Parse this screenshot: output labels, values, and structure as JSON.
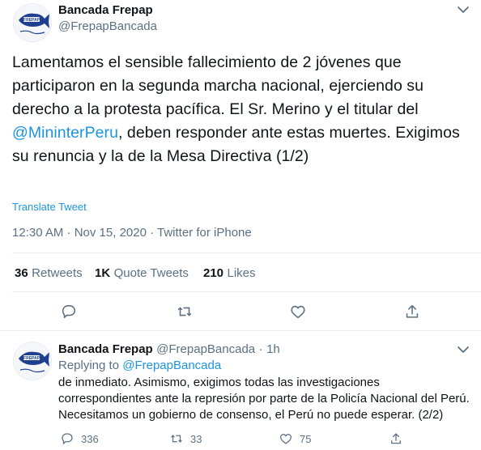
{
  "main_tweet": {
    "author_name": "Bancada Frepap",
    "author_handle": "@FrepapBancada",
    "avatar_text": "FREPAP",
    "text_before_mention": "Lamentamos el sensible fallecimiento de 2 jóvenes que participaron en la segunda marcha nacional, ejerciendo su derecho a la protesta pacífica. El Sr. Merino y el titular del ",
    "mention": "@MininterPeru",
    "text_after_mention": ", deben responder ante estas muertes. Exigimos su renuncia y la de la Mesa Directiva (1/2)",
    "translate_label": "Translate Tweet",
    "timestamp": "12:30 AM · Nov 15, 2020 · Twitter for iPhone"
  },
  "stats": {
    "retweets_count": "36",
    "retweets_label": "Retweets",
    "quotes_count": "1K",
    "quotes_label": "Quote Tweets",
    "likes_count": "210",
    "likes_label": "Likes"
  },
  "actions": {
    "icons": [
      "reply-icon",
      "retweet-icon",
      "like-icon",
      "share-icon"
    ]
  },
  "reply_tweet": {
    "author_name": "Bancada Frepap",
    "author_handle": "@FrepapBancada",
    "separator": "·",
    "time": "1h",
    "replying_prefix": "Replying to ",
    "replying_to": "@FrepapBancada",
    "text": "de inmediato. Asimismo, exigimos todas las investigaciones correspondientes ante la represión por parte de la Policía Nacional del Perú. Necesitamos un gobierno de consenso, el Perú no puede esperar. (2/2)",
    "reply_count": "336",
    "retweet_count": "33",
    "like_count": "75"
  },
  "colors": {
    "link": "#1b95e0",
    "secondary_text": "#5b7083",
    "divider": "#e6ecf0",
    "avatar_fish": "#1f3f8f"
  }
}
